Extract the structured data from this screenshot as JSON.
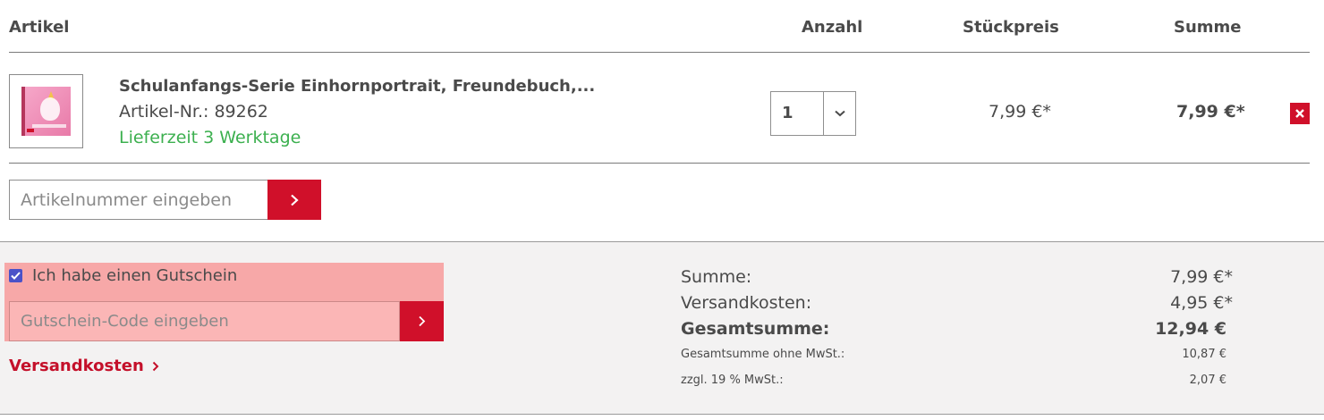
{
  "table_header": {
    "artikel": "Artikel",
    "anzahl": "Anzahl",
    "stueckpreis": "Stückpreis",
    "summe": "Summe"
  },
  "item": {
    "title": "Schulanfangs-Serie Einhornportrait, Freundebuch,...",
    "article_number": "Artikel-Nr.: 89262",
    "delivery": "Lieferzeit 3 Werktage",
    "quantity": "1",
    "unit_price": "7,99 €*",
    "line_total": "7,99 €*",
    "thumbnail_icon": "product-thumbnail"
  },
  "article_input": {
    "placeholder": "Artikelnummer eingeben"
  },
  "voucher": {
    "checked": true,
    "label": "Ich habe einen Gutschein",
    "placeholder": "Gutschein-Code eingeben"
  },
  "shipping_link": "Versandkosten",
  "totals": {
    "summe_label": "Summe:",
    "summe_value": "7,99 €*",
    "versand_label": "Versandkosten:",
    "versand_value": "4,95 €*",
    "gesamt_label": "Gesamtsumme:",
    "gesamt_value": "12,94 €",
    "netto_label": "Gesamtsumme ohne MwSt.:",
    "netto_value": "10,87 €",
    "mwst_label": "zzgl. 19 % MwSt.:",
    "mwst_value": "2,07 €"
  },
  "colors": {
    "accent": "#d0102a",
    "delivery_green": "#3cb04f",
    "highlight": "#f7a8a8",
    "footer_bg": "#f3f2f2"
  }
}
